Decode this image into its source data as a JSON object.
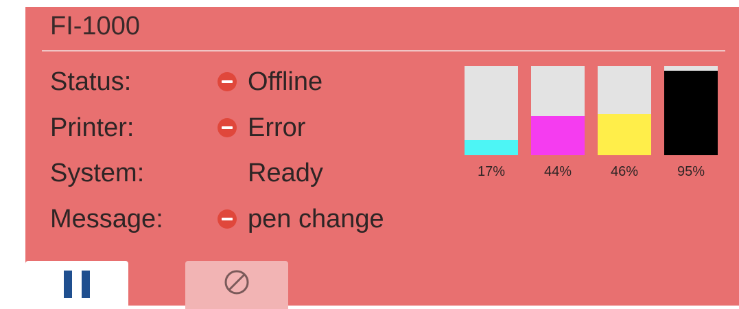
{
  "device": {
    "title": "FI-1000"
  },
  "status_rows": [
    {
      "label": "Status:",
      "value": "Offline",
      "icon": "error-minus-icon"
    },
    {
      "label": "Printer:",
      "value": "Error",
      "icon": "error-minus-icon"
    },
    {
      "label": "System:",
      "value": "Ready",
      "icon": null
    },
    {
      "label": "Message:",
      "value": "pen change",
      "icon": "error-minus-icon"
    }
  ],
  "ink_levels": [
    {
      "name": "cyan",
      "level": 17,
      "label": "17%",
      "color": "#4df5f5"
    },
    {
      "name": "magenta",
      "level": 44,
      "label": "44%",
      "color": "#f53cf0"
    },
    {
      "name": "yellow",
      "level": 46,
      "label": "46%",
      "color": "#ffee4a"
    },
    {
      "name": "black",
      "level": 95,
      "label": "95%",
      "color": "#000000"
    }
  ],
  "controls": {
    "pause_icon": "pause-icon",
    "cancel_icon": "cancel-icon"
  },
  "colors": {
    "panel_background": "#e87070",
    "error_icon": "#e0473b",
    "pause_icon": "#1f4f8f",
    "cancel_button": "#f2b4b4"
  }
}
